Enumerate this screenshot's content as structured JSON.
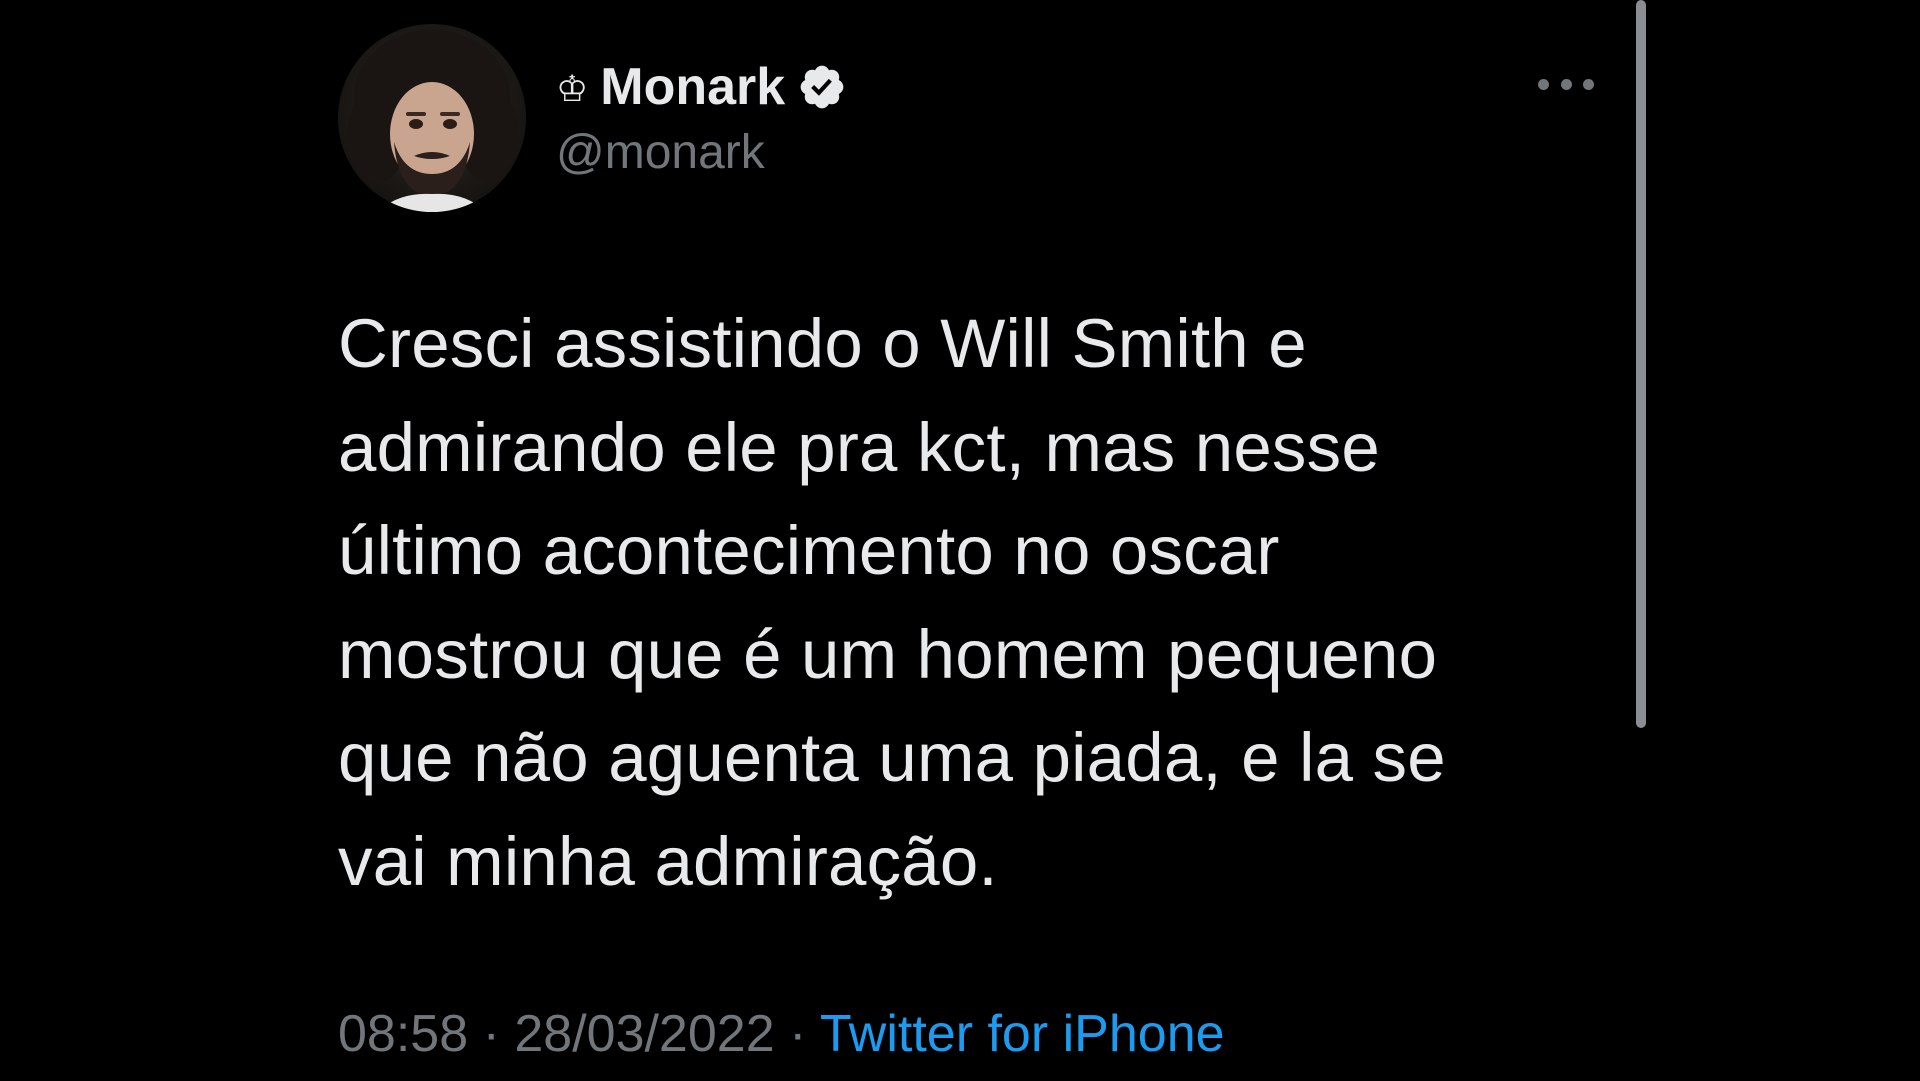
{
  "author": {
    "crown_glyph": "♔",
    "display_name": "Monark",
    "handle": "@monark",
    "verified": true,
    "avatar_icon": "profile-photo"
  },
  "tweet": {
    "lines": [
      "Cresci assistindo o Will Smith e",
      "admirando ele pra kct, mas nesse",
      "último acontecimento no oscar",
      "mostrou que é um homem pequeno",
      "que não aguenta uma piada, e la se",
      "vai minha admiração."
    ]
  },
  "meta": {
    "time": "08:58",
    "separator": " · ",
    "date": "28/03/2022",
    "source": "Twitter for iPhone"
  },
  "icons": {
    "more": "more-options-icon",
    "verified": "verified-badge-icon"
  },
  "colors": {
    "background": "#000000",
    "primary_text": "#e7e9ea",
    "secondary_text": "#71767b",
    "link": "#1d9bf0"
  }
}
